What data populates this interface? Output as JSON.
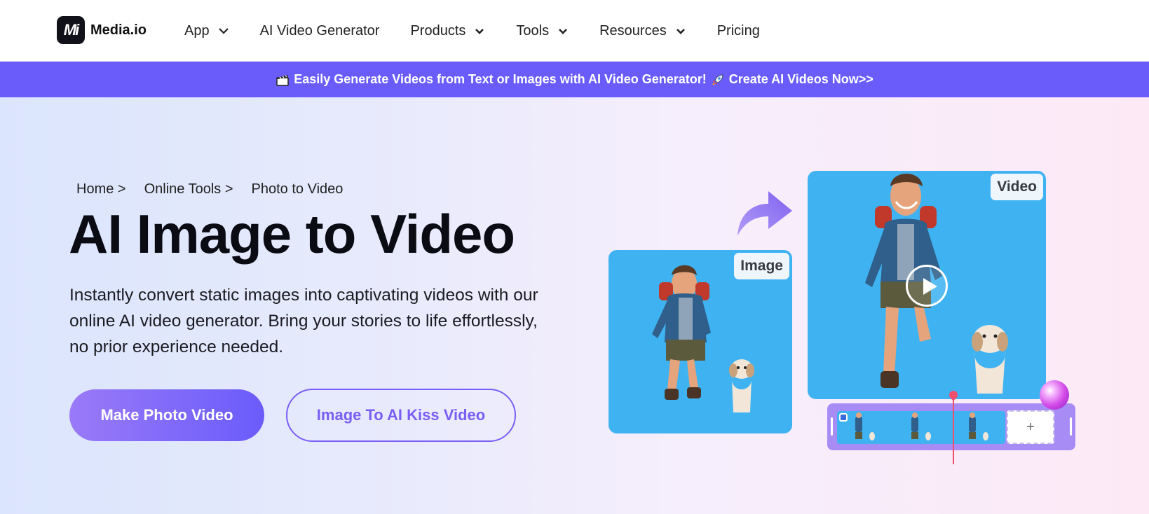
{
  "header": {
    "logo_mark": "Mi",
    "logo_text": "Media.io",
    "nav": [
      {
        "label": "App",
        "has_dropdown": true
      },
      {
        "label": "AI Video Generator",
        "has_dropdown": false
      },
      {
        "label": "Products",
        "has_dropdown": true
      },
      {
        "label": "Tools",
        "has_dropdown": true
      },
      {
        "label": "Resources",
        "has_dropdown": true
      },
      {
        "label": "Pricing",
        "has_dropdown": false
      }
    ]
  },
  "banner": {
    "text": "Easily Generate Videos from Text or Images with AI Video Generator!",
    "cta": "Create AI Videos Now>>",
    "bg_color": "#6a5cfb"
  },
  "hero": {
    "breadcrumb": [
      "Home >",
      "Online Tools >",
      "Photo to Video"
    ],
    "title": "AI Image to Video",
    "description": "Instantly convert static images into captivating videos with our online AI video generator. Bring your stories to life effortlessly, no prior experience needed.",
    "primary_button": "Make Photo Video",
    "secondary_button": "Image To AI Kiss Video",
    "accent_color": "#7a5ef5"
  },
  "illustration": {
    "image_label": "Image",
    "video_label": "Video",
    "timeline_add": "+"
  }
}
